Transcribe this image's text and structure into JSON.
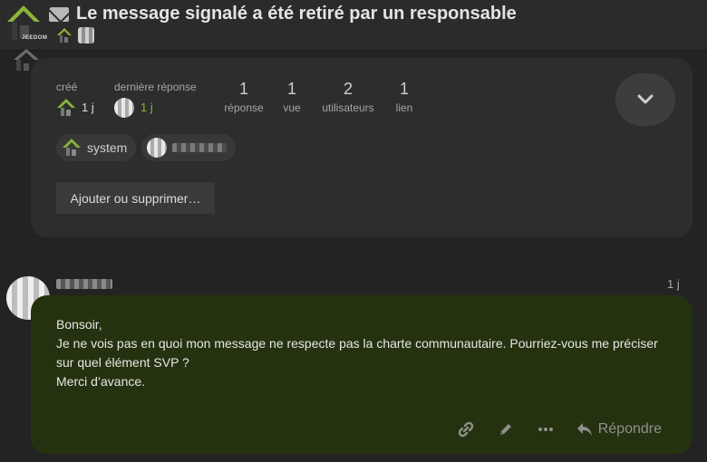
{
  "header": {
    "title": "Le message signalé a été retiré par un responsable",
    "logo_text": "JEEDOM"
  },
  "topic_map": {
    "created": {
      "label": "créé",
      "value": "1 j"
    },
    "last_reply": {
      "label": "dernière réponse",
      "value": "1 j"
    },
    "stats": [
      {
        "num": "1",
        "word": "réponse"
      },
      {
        "num": "1",
        "word": "vue"
      },
      {
        "num": "2",
        "word": "utilisateurs"
      },
      {
        "num": "1",
        "word": "lien"
      }
    ],
    "participants": [
      {
        "label": "system"
      }
    ],
    "add_button": "Ajouter ou supprimer…"
  },
  "post": {
    "date": "1 j",
    "lines": [
      "Bonsoir,",
      "Je ne vois pas en quoi mon message ne respecte pas la charte communautaire. Pourriez-vous me préciser sur quel élément SVP ?",
      "Merci d’avance."
    ],
    "reply_label": "Répondre"
  },
  "colors": {
    "accent_green": "#8ab43a",
    "post_background": "#25320f",
    "card_background": "#2d2d2d"
  },
  "icons": [
    "envelope-icon",
    "chevron-down-icon",
    "link-icon",
    "pencil-icon",
    "more-icon",
    "reply-icon",
    "jeedom-logo-icon"
  ]
}
